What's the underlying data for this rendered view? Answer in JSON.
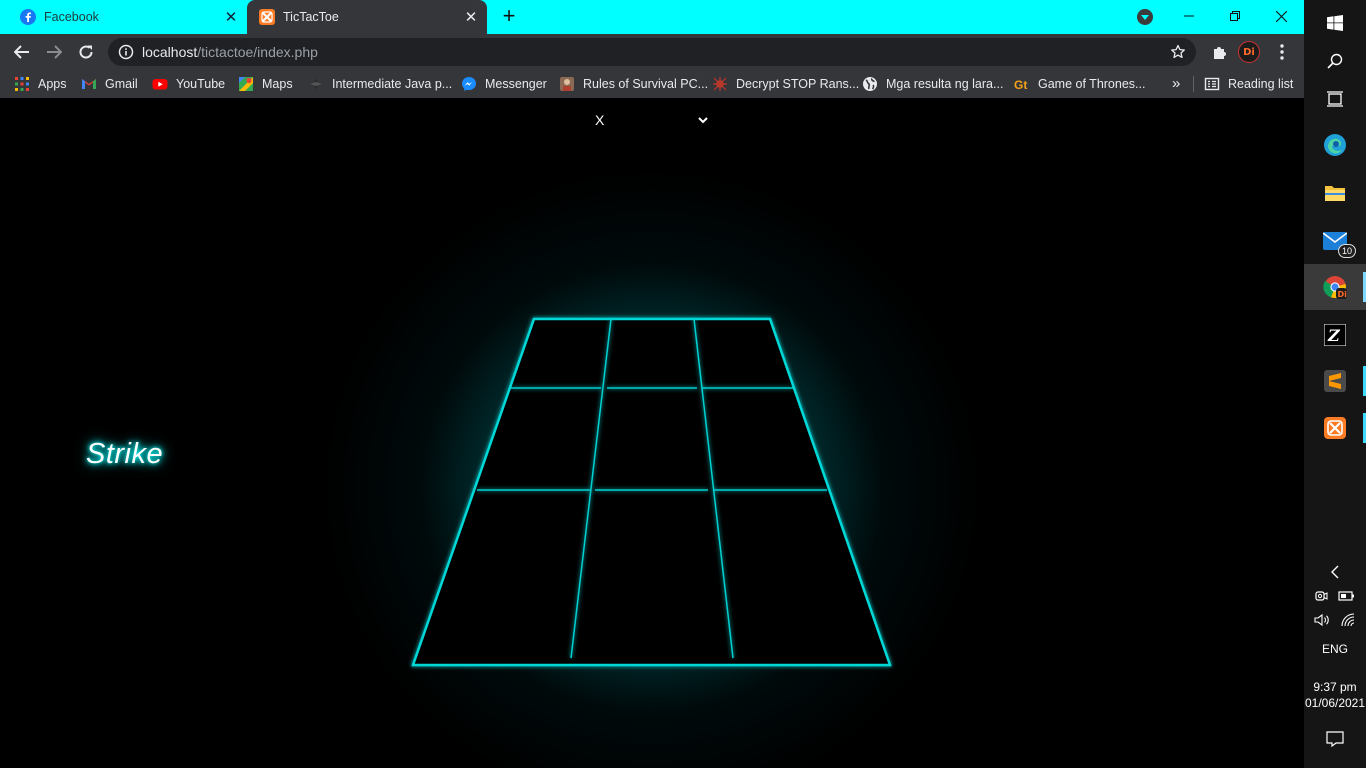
{
  "browser": {
    "tabs": [
      {
        "title": "Facebook",
        "active": false
      },
      {
        "title": "TicTacToe",
        "active": true
      }
    ],
    "address": {
      "host": "localhost",
      "path": "/tictactoe/index.php"
    },
    "bookmarks": [
      {
        "label": "Apps",
        "icon": "apps-grid-icon"
      },
      {
        "label": "Gmail",
        "icon": "gmail-icon"
      },
      {
        "label": "YouTube",
        "icon": "youtube-icon"
      },
      {
        "label": "Maps",
        "icon": "maps-icon"
      },
      {
        "label": "Intermediate Java p...",
        "icon": "java-icon"
      },
      {
        "label": "Messenger",
        "icon": "messenger-icon"
      },
      {
        "label": "Rules of Survival PC...",
        "icon": "ros-icon"
      },
      {
        "label": "Decrypt STOP Rans...",
        "icon": "decrypt-icon"
      },
      {
        "label": "Mga resulta ng lara...",
        "icon": "globe-icon"
      },
      {
        "label": "Game of Thrones...",
        "icon": "got-icon"
      }
    ],
    "bookmarks_more": "»",
    "reading_list": "Reading list",
    "profile_initials": "Di",
    "tab_bar_color": "#00ffff"
  },
  "game": {
    "selected_player": "X",
    "strike_text": "Strike",
    "accent_color": "#00e5e5"
  },
  "taskbar": {
    "mail_badge": "10",
    "language": "ENG",
    "time": "9:37 pm",
    "date": "01/06/2021"
  }
}
